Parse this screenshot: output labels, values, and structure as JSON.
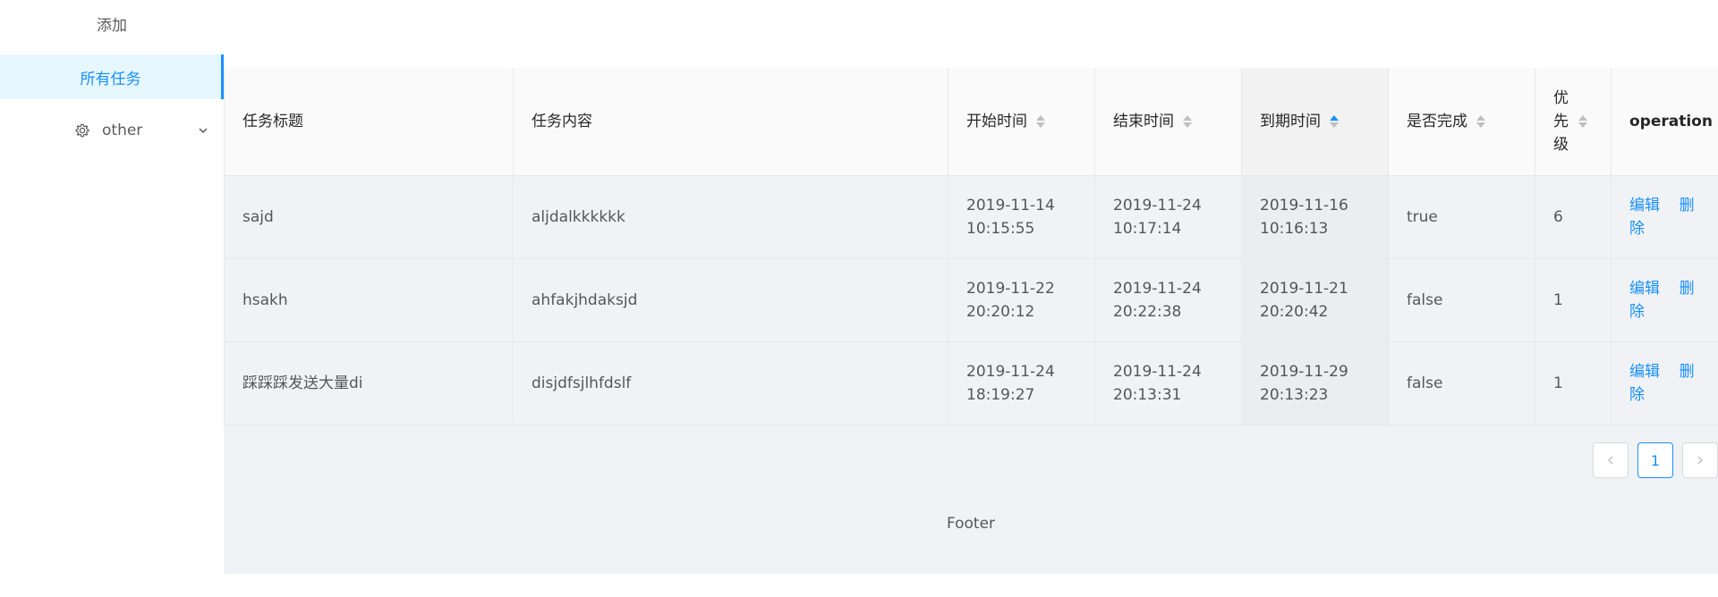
{
  "sidebar": {
    "add_label": "添加",
    "all_tasks_label": "所有任务",
    "other_label": "other"
  },
  "table": {
    "columns": {
      "title": "任务标题",
      "content": "任务内容",
      "start": "开始时间",
      "end": "结束时间",
      "due": "到期时间",
      "done": "是否完成",
      "priority": "优\n先\n级",
      "operation": "operation"
    },
    "rows": [
      {
        "title": "sajd",
        "content": "aljdalkkkkkk",
        "start": "2019-11-14 10:15:55",
        "end": "2019-11-24 10:17:14",
        "due": "2019-11-16 10:16:13",
        "done": "true",
        "priority": "6",
        "edit": "编辑",
        "delete": "删除"
      },
      {
        "title": "hsakh",
        "content": "ahfakjhdaksjd",
        "start": "2019-11-22 20:20:12",
        "end": "2019-11-24 20:22:38",
        "due": "2019-11-21 20:20:42",
        "done": "false",
        "priority": "1",
        "edit": "编辑",
        "delete": "删除"
      },
      {
        "title": "踩踩踩发送大量di",
        "content": "disjdfsjlhfdslf",
        "start": "2019-11-24 18:19:27",
        "end": "2019-11-24 20:13:31",
        "due": "2019-11-29 20:13:23",
        "done": "false",
        "priority": "1",
        "edit": "编辑",
        "delete": "删除"
      }
    ]
  },
  "pagination": {
    "current": "1"
  },
  "footer": {
    "text": "Footer"
  },
  "colors": {
    "accent": "#1890ff",
    "selected_bg": "#e6f7ff",
    "content_bg": "#f0f2f5"
  }
}
